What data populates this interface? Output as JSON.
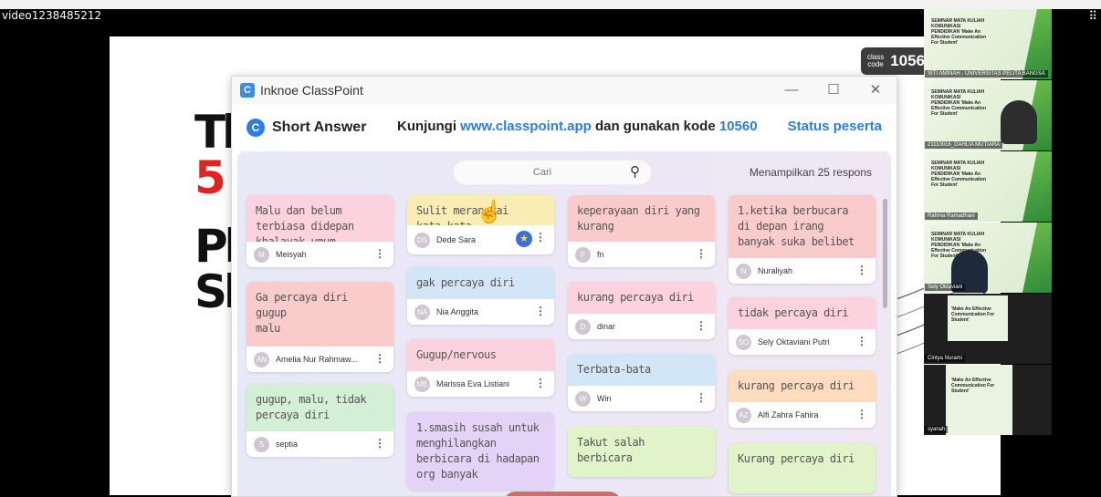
{
  "video_label": "video1238485212",
  "slide": {
    "big_letters": [
      "Tl",
      "5",
      "Pl",
      "Sl"
    ],
    "class_code_label": "class code",
    "class_code_value": "1056"
  },
  "window": {
    "title": "Inknoe ClassPoint",
    "activity": "Short Answer",
    "instruction_prefix": "Kunjungi",
    "instruction_url": "www.classpoint.app",
    "instruction_mid": "dan gunakan kode",
    "instruction_code": "10560",
    "status_link": "Status peserta",
    "search_placeholder": "Cari",
    "count_text": "Menampilkan 25 respons"
  },
  "responses": [
    {
      "text": "Malu dan belum terbiasa didepan khalayak umum",
      "initials": "M",
      "name": "Meisyah"
    },
    {
      "text": "Ga percaya diri\ngugup\nmalu",
      "initials": "AN",
      "name": "Amelia Nur Rahmaw..."
    },
    {
      "text": "gugup, malu, tidak percaya diri",
      "initials": "S",
      "name": "septia"
    },
    {
      "text": "Sulit merangkai kata-kata",
      "initials": "DS",
      "name": "Dede Sara"
    },
    {
      "text": "gak percaya diri",
      "initials": "NA",
      "name": "Nia Anggita"
    },
    {
      "text": "Gugup/nervous",
      "initials": "ME",
      "name": "Marissa Eva Listiani"
    },
    {
      "text": "1.smasih susah untuk menghilangkan berbicara di hadapan org banyak",
      "initials": "",
      "name": ""
    },
    {
      "text": "keperayaan diri yang kurang",
      "initials": "F",
      "name": "fn"
    },
    {
      "text": "kurang percaya diri",
      "initials": "D",
      "name": "dinar"
    },
    {
      "text": "Terbata-bata",
      "initials": "W",
      "name": "Win"
    },
    {
      "text": "Takut salah berbicara",
      "initials": "",
      "name": ""
    },
    {
      "text": "1.ketika berbucara di depan irang banyak suka belibet",
      "initials": "N",
      "name": "Nuraliyah"
    },
    {
      "text": "tidak percaya diri",
      "initials": "SO",
      "name": "Sely Oktaviani Putri"
    },
    {
      "text": "kurang percaya diri",
      "initials": "AZ",
      "name": "Alfi Zahra Fahira"
    },
    {
      "text": "Kurang percaya diri",
      "initials": "",
      "name": ""
    }
  ],
  "participants": [
    {
      "name": "SITI AMINAH - UNIVERSITAS PELITA BANGSA",
      "mini": "SEMINAR MATA KULIAH KOMUNIKASI PENDIDIKAN 'Make An Effective Communication For Student'"
    },
    {
      "name": "21110016_DAHLIA MUTIARA",
      "mini": "SEMINAR MATA KULIAH KOMUNIKASI PENDIDIKAN 'Make An Effective Communication For Student'"
    },
    {
      "name": "Rahma Ramadhani",
      "mini": "SEMINAR MATA KULIAH KOMUNIKASI PENDIDIKAN 'Make An Effective Communication For Student'"
    },
    {
      "name": "Sely Oktaviani",
      "mini": "SEMINAR MATA KULIAH KOMUNIKASI PENDIDIKAN 'Make An Effective Communication For Student'"
    },
    {
      "name": "Cintya Nurami",
      "mini": "'Make An Effective Communication For Student'"
    },
    {
      "name": "syanah",
      "mini": "'Make An Effective Communication For Student'"
    }
  ]
}
